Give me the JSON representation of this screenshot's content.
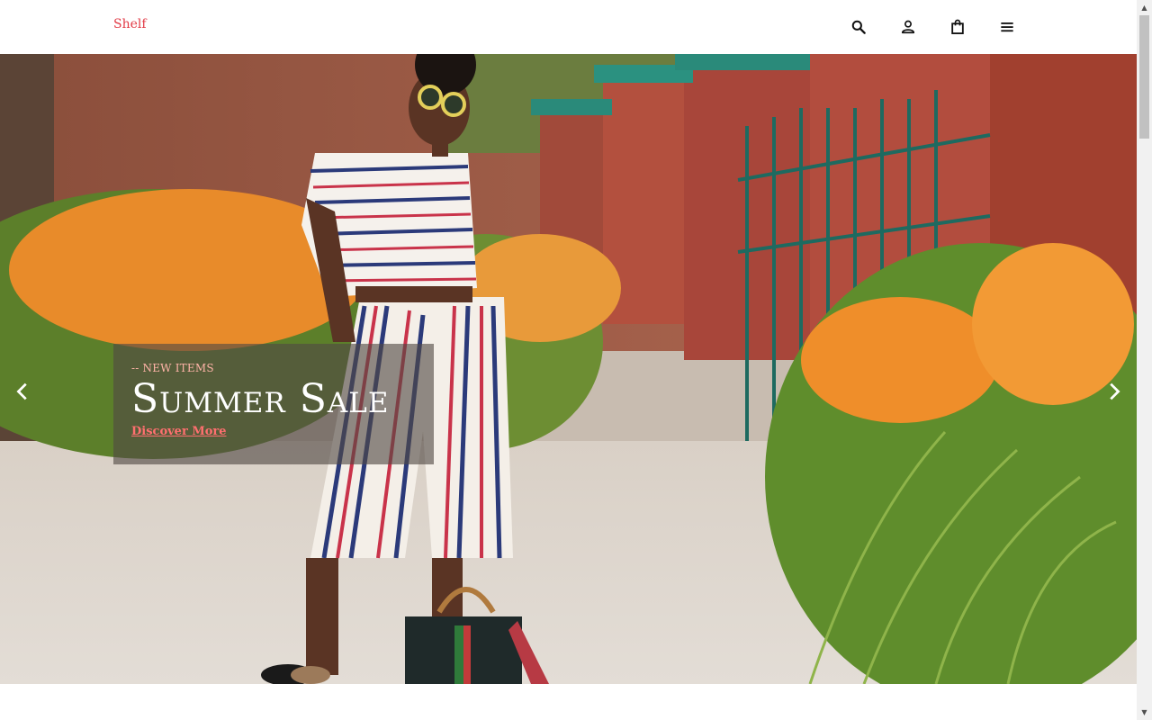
{
  "header": {
    "brand": "Shelf",
    "icons": [
      "search-icon",
      "user-icon",
      "shopping-bag-icon",
      "menu-icon"
    ]
  },
  "hero": {
    "eyebrow": "-- NEW ITEMS",
    "headline": "Summer Sale",
    "cta": "Discover More",
    "prev_icon": "chevron-left-icon",
    "next_icon": "chevron-right-icon"
  },
  "colors": {
    "brand": "#e23a45",
    "cta": "#ff6f6f",
    "caption_bg": "rgba(80,72,68,0.62)"
  }
}
